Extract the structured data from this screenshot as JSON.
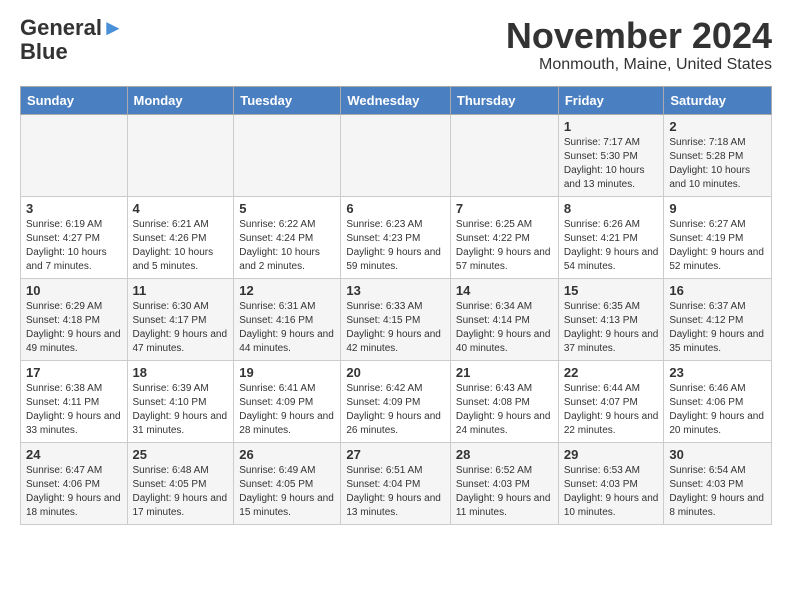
{
  "header": {
    "logo_line1": "General",
    "logo_line2": "Blue",
    "title": "November 2024",
    "subtitle": "Monmouth, Maine, United States"
  },
  "calendar": {
    "days_of_week": [
      "Sunday",
      "Monday",
      "Tuesday",
      "Wednesday",
      "Thursday",
      "Friday",
      "Saturday"
    ],
    "weeks": [
      [
        {
          "day": "",
          "sunrise": "",
          "sunset": "",
          "daylight": ""
        },
        {
          "day": "",
          "sunrise": "",
          "sunset": "",
          "daylight": ""
        },
        {
          "day": "",
          "sunrise": "",
          "sunset": "",
          "daylight": ""
        },
        {
          "day": "",
          "sunrise": "",
          "sunset": "",
          "daylight": ""
        },
        {
          "day": "",
          "sunrise": "",
          "sunset": "",
          "daylight": ""
        },
        {
          "day": "1",
          "sunrise": "Sunrise: 7:17 AM",
          "sunset": "Sunset: 5:30 PM",
          "daylight": "Daylight: 10 hours and 13 minutes."
        },
        {
          "day": "2",
          "sunrise": "Sunrise: 7:18 AM",
          "sunset": "Sunset: 5:28 PM",
          "daylight": "Daylight: 10 hours and 10 minutes."
        }
      ],
      [
        {
          "day": "3",
          "sunrise": "Sunrise: 6:19 AM",
          "sunset": "Sunset: 4:27 PM",
          "daylight": "Daylight: 10 hours and 7 minutes."
        },
        {
          "day": "4",
          "sunrise": "Sunrise: 6:21 AM",
          "sunset": "Sunset: 4:26 PM",
          "daylight": "Daylight: 10 hours and 5 minutes."
        },
        {
          "day": "5",
          "sunrise": "Sunrise: 6:22 AM",
          "sunset": "Sunset: 4:24 PM",
          "daylight": "Daylight: 10 hours and 2 minutes."
        },
        {
          "day": "6",
          "sunrise": "Sunrise: 6:23 AM",
          "sunset": "Sunset: 4:23 PM",
          "daylight": "Daylight: 9 hours and 59 minutes."
        },
        {
          "day": "7",
          "sunrise": "Sunrise: 6:25 AM",
          "sunset": "Sunset: 4:22 PM",
          "daylight": "Daylight: 9 hours and 57 minutes."
        },
        {
          "day": "8",
          "sunrise": "Sunrise: 6:26 AM",
          "sunset": "Sunset: 4:21 PM",
          "daylight": "Daylight: 9 hours and 54 minutes."
        },
        {
          "day": "9",
          "sunrise": "Sunrise: 6:27 AM",
          "sunset": "Sunset: 4:19 PM",
          "daylight": "Daylight: 9 hours and 52 minutes."
        }
      ],
      [
        {
          "day": "10",
          "sunrise": "Sunrise: 6:29 AM",
          "sunset": "Sunset: 4:18 PM",
          "daylight": "Daylight: 9 hours and 49 minutes."
        },
        {
          "day": "11",
          "sunrise": "Sunrise: 6:30 AM",
          "sunset": "Sunset: 4:17 PM",
          "daylight": "Daylight: 9 hours and 47 minutes."
        },
        {
          "day": "12",
          "sunrise": "Sunrise: 6:31 AM",
          "sunset": "Sunset: 4:16 PM",
          "daylight": "Daylight: 9 hours and 44 minutes."
        },
        {
          "day": "13",
          "sunrise": "Sunrise: 6:33 AM",
          "sunset": "Sunset: 4:15 PM",
          "daylight": "Daylight: 9 hours and 42 minutes."
        },
        {
          "day": "14",
          "sunrise": "Sunrise: 6:34 AM",
          "sunset": "Sunset: 4:14 PM",
          "daylight": "Daylight: 9 hours and 40 minutes."
        },
        {
          "day": "15",
          "sunrise": "Sunrise: 6:35 AM",
          "sunset": "Sunset: 4:13 PM",
          "daylight": "Daylight: 9 hours and 37 minutes."
        },
        {
          "day": "16",
          "sunrise": "Sunrise: 6:37 AM",
          "sunset": "Sunset: 4:12 PM",
          "daylight": "Daylight: 9 hours and 35 minutes."
        }
      ],
      [
        {
          "day": "17",
          "sunrise": "Sunrise: 6:38 AM",
          "sunset": "Sunset: 4:11 PM",
          "daylight": "Daylight: 9 hours and 33 minutes."
        },
        {
          "day": "18",
          "sunrise": "Sunrise: 6:39 AM",
          "sunset": "Sunset: 4:10 PM",
          "daylight": "Daylight: 9 hours and 31 minutes."
        },
        {
          "day": "19",
          "sunrise": "Sunrise: 6:41 AM",
          "sunset": "Sunset: 4:09 PM",
          "daylight": "Daylight: 9 hours and 28 minutes."
        },
        {
          "day": "20",
          "sunrise": "Sunrise: 6:42 AM",
          "sunset": "Sunset: 4:09 PM",
          "daylight": "Daylight: 9 hours and 26 minutes."
        },
        {
          "day": "21",
          "sunrise": "Sunrise: 6:43 AM",
          "sunset": "Sunset: 4:08 PM",
          "daylight": "Daylight: 9 hours and 24 minutes."
        },
        {
          "day": "22",
          "sunrise": "Sunrise: 6:44 AM",
          "sunset": "Sunset: 4:07 PM",
          "daylight": "Daylight: 9 hours and 22 minutes."
        },
        {
          "day": "23",
          "sunrise": "Sunrise: 6:46 AM",
          "sunset": "Sunset: 4:06 PM",
          "daylight": "Daylight: 9 hours and 20 minutes."
        }
      ],
      [
        {
          "day": "24",
          "sunrise": "Sunrise: 6:47 AM",
          "sunset": "Sunset: 4:06 PM",
          "daylight": "Daylight: 9 hours and 18 minutes."
        },
        {
          "day": "25",
          "sunrise": "Sunrise: 6:48 AM",
          "sunset": "Sunset: 4:05 PM",
          "daylight": "Daylight: 9 hours and 17 minutes."
        },
        {
          "day": "26",
          "sunrise": "Sunrise: 6:49 AM",
          "sunset": "Sunset: 4:05 PM",
          "daylight": "Daylight: 9 hours and 15 minutes."
        },
        {
          "day": "27",
          "sunrise": "Sunrise: 6:51 AM",
          "sunset": "Sunset: 4:04 PM",
          "daylight": "Daylight: 9 hours and 13 minutes."
        },
        {
          "day": "28",
          "sunrise": "Sunrise: 6:52 AM",
          "sunset": "Sunset: 4:03 PM",
          "daylight": "Daylight: 9 hours and 11 minutes."
        },
        {
          "day": "29",
          "sunrise": "Sunrise: 6:53 AM",
          "sunset": "Sunset: 4:03 PM",
          "daylight": "Daylight: 9 hours and 10 minutes."
        },
        {
          "day": "30",
          "sunrise": "Sunrise: 6:54 AM",
          "sunset": "Sunset: 4:03 PM",
          "daylight": "Daylight: 9 hours and 8 minutes."
        }
      ]
    ]
  }
}
